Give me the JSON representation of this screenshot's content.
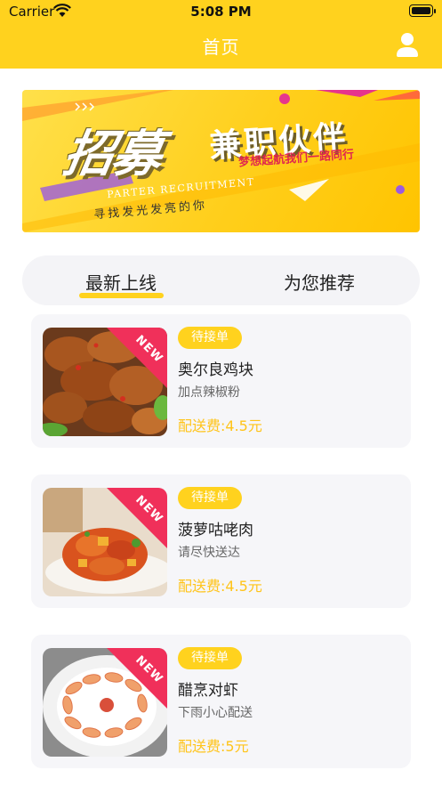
{
  "status_bar": {
    "carrier": "Carrier",
    "time": "5:08 PM"
  },
  "nav": {
    "title": "首页",
    "profile_icon": "user-icon"
  },
  "banner": {
    "title_main": "招募",
    "title_side": "兼职伙伴",
    "slogan": "梦想起航我们一路同行",
    "english": "PARTER RECRUITMENT",
    "tagline": "寻找发光发亮的你"
  },
  "tabs": [
    {
      "label": "最新上线",
      "active": true
    },
    {
      "label": "为您推荐",
      "active": false
    }
  ],
  "orders": [
    {
      "status": "待接单",
      "name": "奥尔良鸡块",
      "note": "加点辣椒粉",
      "fee": "配送费:4.5元",
      "ribbon": "NEW"
    },
    {
      "status": "待接单",
      "name": "菠萝咕咾肉",
      "note": "请尽快送达",
      "fee": "配送费:4.5元",
      "ribbon": "NEW"
    },
    {
      "status": "待接单",
      "name": "醋烹对虾",
      "note": "下雨小心配送",
      "fee": "配送费:5元",
      "ribbon": "NEW"
    }
  ],
  "colors": {
    "accent": "#FFD21E",
    "ribbon": "#F0305A",
    "fee": "#FFC41A",
    "card_bg": "#F6F6F9"
  }
}
